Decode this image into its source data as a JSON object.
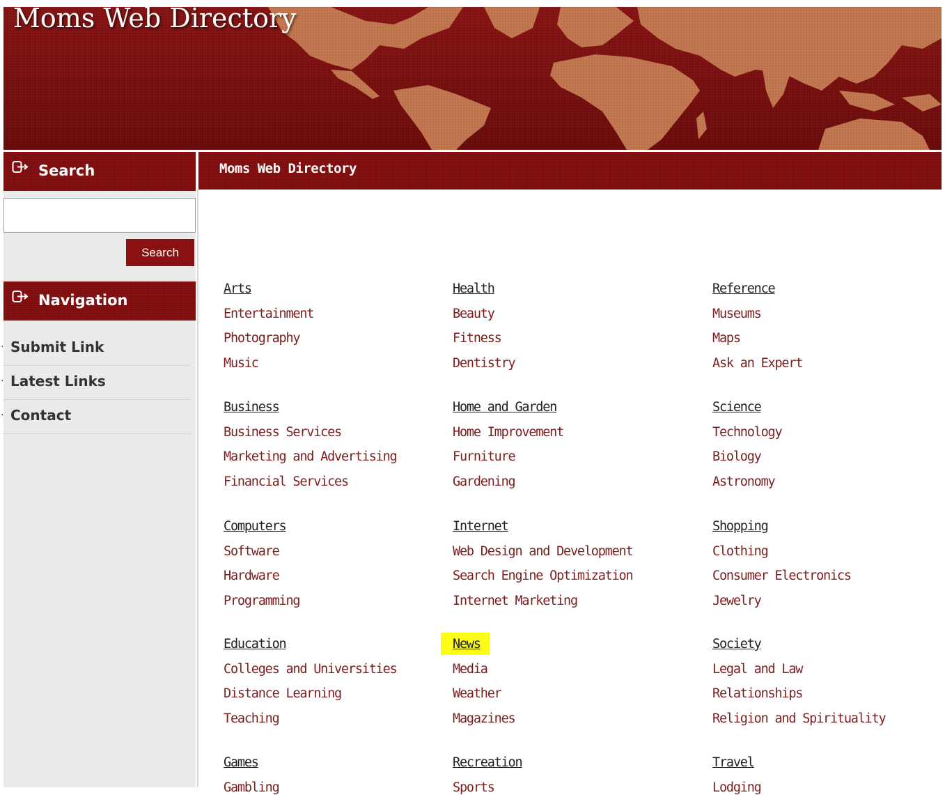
{
  "site": {
    "title": "Moms Web Directory"
  },
  "sidebar": {
    "search_heading": "Search",
    "search_input_value": "",
    "search_button_label": "Search",
    "nav_heading": "Navigation",
    "nav_items": [
      {
        "label": "Submit Link"
      },
      {
        "label": "Latest Links"
      },
      {
        "label": "Contact"
      }
    ]
  },
  "main": {
    "heading": "Moms Web Directory",
    "categories": [
      {
        "title": "Arts",
        "subs": [
          "Entertainment",
          "Photography",
          "Music"
        ]
      },
      {
        "title": "Health",
        "subs": [
          "Beauty",
          "Fitness",
          "Dentistry"
        ]
      },
      {
        "title": "Reference",
        "subs": [
          "Museums",
          "Maps",
          "Ask an Expert"
        ]
      },
      {
        "title": "Business",
        "subs": [
          "Business Services",
          "Marketing and Advertising",
          "Financial Services"
        ]
      },
      {
        "title": "Home and Garden",
        "subs": [
          "Home Improvement",
          "Furniture",
          "Gardening"
        ]
      },
      {
        "title": "Science",
        "subs": [
          "Technology",
          "Biology",
          "Astronomy"
        ]
      },
      {
        "title": "Computers",
        "subs": [
          "Software",
          "Hardware",
          "Programming"
        ]
      },
      {
        "title": "Internet",
        "subs": [
          "Web Design and Development",
          "Search Engine Optimization",
          "Internet Marketing"
        ]
      },
      {
        "title": "Shopping",
        "subs": [
          "Clothing",
          "Consumer Electronics",
          "Jewelry"
        ]
      },
      {
        "title": "Education",
        "subs": [
          "Colleges and Universities",
          "Distance Learning",
          "Teaching"
        ]
      },
      {
        "title": "News",
        "subs": [
          "Media",
          "Weather",
          "Magazines"
        ],
        "highlighted": true
      },
      {
        "title": "Society",
        "subs": [
          "Legal and Law",
          "Relationships",
          "Religion and Spirituality"
        ]
      },
      {
        "title": "Games",
        "subs": [
          "Gambling"
        ]
      },
      {
        "title": "Recreation",
        "subs": [
          "Sports"
        ]
      },
      {
        "title": "Travel",
        "subs": [
          "Lodging"
        ]
      }
    ]
  },
  "colors": {
    "brand_red": "#8a1111",
    "header_red": "#7d1212",
    "link_red": "#7a1e1e",
    "map_land": "#c27850",
    "highlight": "#fcfc18"
  },
  "icons": {
    "section_heading_icon": "arrow-into-box-icon"
  }
}
